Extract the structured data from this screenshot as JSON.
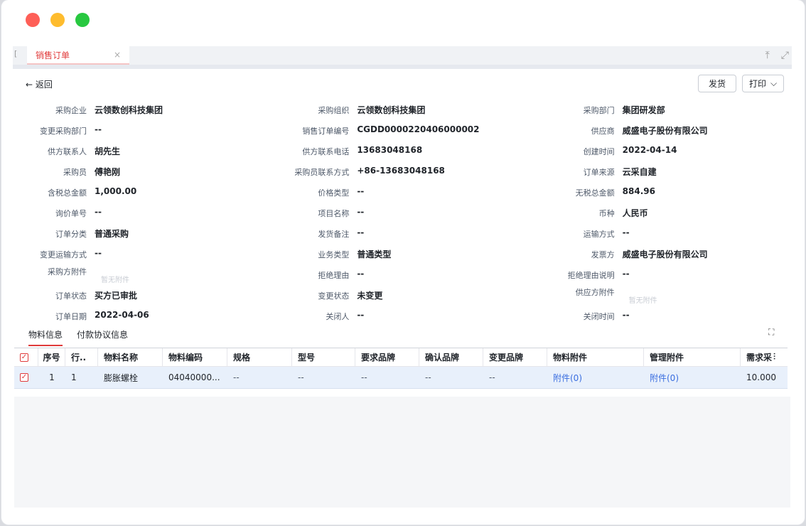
{
  "tabs": [
    {
      "label": "销售订单"
    }
  ],
  "tab_close": "×",
  "left_edge": "[",
  "toolbar": {
    "upload_icon": "⤒",
    "fullscreen_icon": "⤢"
  },
  "back_label": "← 返回",
  "actions": {
    "ship": "发货",
    "print": "打印",
    "print_caret": "⌵"
  },
  "fields": [
    [
      {
        "label": "采购企业",
        "value": "云领数创科技集团"
      },
      {
        "label": "采购组织",
        "value": "云领数创科技集团"
      },
      {
        "label": "采购部门",
        "value": "集团研发部"
      }
    ],
    [
      {
        "label": "变更采购部门",
        "value": "--"
      },
      {
        "label": "销售订单编号",
        "value": "CGDD0000220406000002"
      },
      {
        "label": "供应商",
        "value": "威盛电子股份有限公司"
      }
    ],
    [
      {
        "label": "供方联系人",
        "value": "胡先生"
      },
      {
        "label": "供方联系电话",
        "value": "13683048168"
      },
      {
        "label": "创建时间",
        "value": "2022-04-14"
      }
    ],
    [
      {
        "label": "采购员",
        "value": "傅艳刚"
      },
      {
        "label": "采购员联系方式",
        "value": "+86-13683048168"
      },
      {
        "label": "订单来源",
        "value": "云采自建"
      }
    ],
    [
      {
        "label": "含税总金额",
        "value": "1,000.00"
      },
      {
        "label": "价格类型",
        "value": "--"
      },
      {
        "label": "无税总金额",
        "value": "884.96"
      }
    ],
    [
      {
        "label": "询价单号",
        "value": "--"
      },
      {
        "label": "项目名称",
        "value": "--"
      },
      {
        "label": "币种",
        "value": "人民币"
      }
    ],
    [
      {
        "label": "订单分类",
        "value": "普通采购"
      },
      {
        "label": "发货备注",
        "value": "--"
      },
      {
        "label": "运输方式",
        "value": "--"
      }
    ],
    [
      {
        "label": "变更运输方式",
        "value": "--"
      },
      {
        "label": "业务类型",
        "value": "普通类型"
      },
      {
        "label": "发票方",
        "value": "威盛电子股份有限公司"
      }
    ],
    [
      {
        "label": "采购方附件",
        "value": "暂无附件"
      },
      {
        "label": "拒绝理由",
        "value": "--"
      },
      {
        "label": "拒绝理由说明",
        "value": "--"
      }
    ],
    [
      {
        "label": "订单状态",
        "value": "买方已审批"
      },
      {
        "label": "变更状态",
        "value": "未变更"
      },
      {
        "label": "供应方附件",
        "value": "暂无附件"
      }
    ],
    [
      {
        "label": "订单日期",
        "value": "2022-04-06"
      },
      {
        "label": "关闭人",
        "value": "--"
      },
      {
        "label": "关闭时间",
        "value": "--"
      }
    ]
  ],
  "subtabs": [
    "物料信息",
    "付款协议信息"
  ],
  "table": {
    "headers": [
      "序号",
      "行..",
      "物料名称",
      "物料编码",
      "规格",
      "型号",
      "要求品牌",
      "确认品牌",
      "变更品牌",
      "物料附件",
      "管理附件",
      "需求采"
    ],
    "rows": [
      [
        "1",
        "1",
        "膨胀螺栓",
        "04040000...",
        "--",
        "--",
        "--",
        "--",
        "--",
        "附件(0)",
        "附件(0)",
        "10.000"
      ]
    ]
  },
  "checkbox_mark": "✓",
  "column_settings_icon": "⫶",
  "expand_icon": "⛶"
}
